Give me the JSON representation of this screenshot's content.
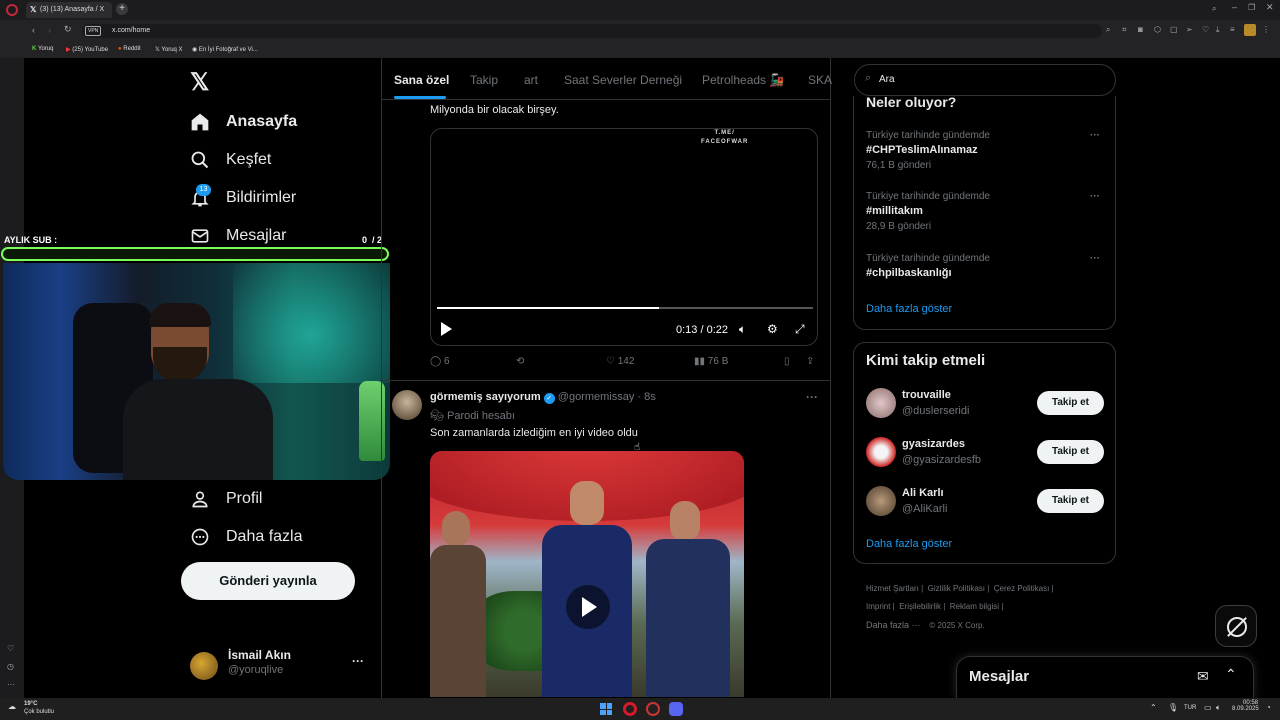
{
  "browser": {
    "tab_title": "(3) (13) Anasayfa / X",
    "url": "x.com/home",
    "vpn_label": "VPN",
    "bookmarks": [
      "Yoruq",
      "(25) YouTube",
      "Reddit",
      "Yoruq X",
      "En İyi Fotoğraf ve Vi..."
    ]
  },
  "nav": {
    "home": "Anasayfa",
    "explore": "Keşfet",
    "notifications": "Bildirimler",
    "notifications_badge": "13",
    "messages": "Mesajlar",
    "profile": "Profil",
    "more": "Daha fazla",
    "post_button": "Gönderi yayınla"
  },
  "account": {
    "name": "İsmail Akın",
    "handle": "@yoruqlive",
    "more": "···"
  },
  "overlay": {
    "label": "AYLIK SUB :",
    "count": "0",
    "goal": "/ 2",
    "progress_fraction": 0.0
  },
  "feed_tabs": [
    "Sana özel",
    "Takip",
    "art",
    "Saat Severler Derneği",
    "Petrolheads 🚂",
    "SKA"
  ],
  "tweet1": {
    "text": "Milyonda bir olacak birşey.",
    "watermark_line1": "T.ME/",
    "watermark_line2": "FACEOFWAR",
    "video_time": "0:13 / 0:22",
    "video_progress": 0.59,
    "replies": "6",
    "likes": "142",
    "views": "76 B"
  },
  "tweet2": {
    "name": "görmemiş sayıyorum",
    "handle": "@gormemissay",
    "time": "· 8s",
    "label": "Parodi hesabı",
    "text": "Son zamanlarda izlediğim en iyi video oldu"
  },
  "search": {
    "placeholder": "Ara"
  },
  "trends": {
    "title": "Neler oluyor?",
    "items": [
      {
        "context": "Türkiye tarihinde gündemde",
        "tag": "#CHPTeslimAlınamaz",
        "count": "76,1 B gönderi"
      },
      {
        "context": "Türkiye tarihinde gündemde",
        "tag": "#millitakım",
        "count": "28,9 B gönderi"
      },
      {
        "context": "Türkiye tarihinde gündemde",
        "tag": "#chpilbaskanlığı",
        "count": ""
      }
    ],
    "show_more": "Daha fazla göster"
  },
  "who_to_follow": {
    "title": "Kimi takip etmeli",
    "users": [
      {
        "name": "trouvaille",
        "handle": "@duslerseridi",
        "button": "Takip et"
      },
      {
        "name": "gyasizardes",
        "handle": "@gyasizardesfb",
        "button": "Takip et"
      },
      {
        "name": "Ali Karlı",
        "handle": "@AliKarli",
        "button": "Takip et"
      }
    ],
    "show_more": "Daha fazla göster"
  },
  "footer": {
    "links": [
      "Hizmet Şartları",
      "Gizlilik Politikası",
      "Çerez Politikası",
      "Imprint",
      "Erişilebilirlik",
      "Reklam bilgisi"
    ],
    "more": "Daha fazla ···",
    "copyright": "© 2025 X Corp."
  },
  "messages_drawer": {
    "title": "Mesajlar"
  },
  "taskbar": {
    "weather_temp": "19°C",
    "weather_desc": "Çok bulutlu",
    "lang": "TUR",
    "time": "00:58",
    "date": "8.09.2025"
  },
  "colors": {
    "accent": "#1d9bf0",
    "overlay_green": "#7cfc5a",
    "background": "#000000"
  }
}
